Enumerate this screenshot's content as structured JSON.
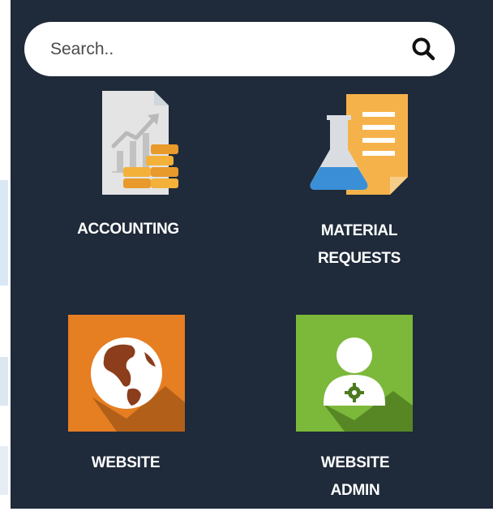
{
  "search": {
    "placeholder": "Search..",
    "icon": "search-icon"
  },
  "apps": [
    {
      "label_line1": "ACCOUNTING",
      "label_line2": "",
      "icon": "accounting-icon"
    },
    {
      "label_line1": "MATERIAL",
      "label_line2": "REQUESTS",
      "icon": "material-requests-icon"
    },
    {
      "label_line1": "WEBSITE",
      "label_line2": "",
      "icon": "website-icon",
      "color": "#e67e22"
    },
    {
      "label_line1": "WEBSITE",
      "label_line2": "ADMIN",
      "icon": "website-admin-icon",
      "color": "#7cb83a"
    }
  ],
  "colors": {
    "panel": "#1f2a3a",
    "search_bg": "#ffffff",
    "label": "#ffffff"
  }
}
